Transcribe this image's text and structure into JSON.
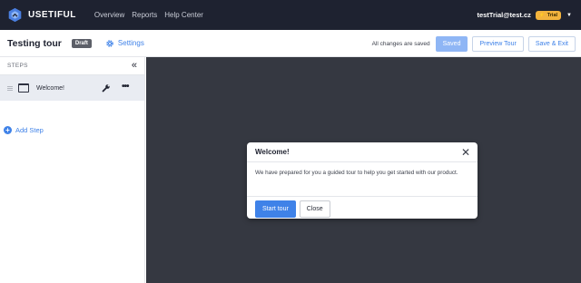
{
  "brand": {
    "name": "USETIFUL"
  },
  "nav": {
    "items": [
      "Overview",
      "Reports",
      "Help Center"
    ]
  },
  "user": {
    "email": "testTrial@test.cz",
    "badge": "Trial"
  },
  "titlebar": {
    "title": "Testing tour",
    "status_badge": "Draft",
    "settings_label": "Settings",
    "saved_status": "All changes are saved",
    "saved_button": "Saved",
    "preview_button": "Preview Tour",
    "save_exit_button": "Save & Exit"
  },
  "sidebar": {
    "header": "STEPS",
    "steps": [
      {
        "label": "Welcome!"
      }
    ],
    "add_step": "Add Step"
  },
  "tour_modal": {
    "title": "Welcome!",
    "body": "We have prepared for you a guided tour to help you get started with our product.",
    "primary_button": "Start tour",
    "secondary_button": "Close"
  },
  "colors": {
    "topbar": "#1e2230",
    "accent": "#3f82e8",
    "canvas": "#353841",
    "trial_badge": "#f2b33d"
  }
}
